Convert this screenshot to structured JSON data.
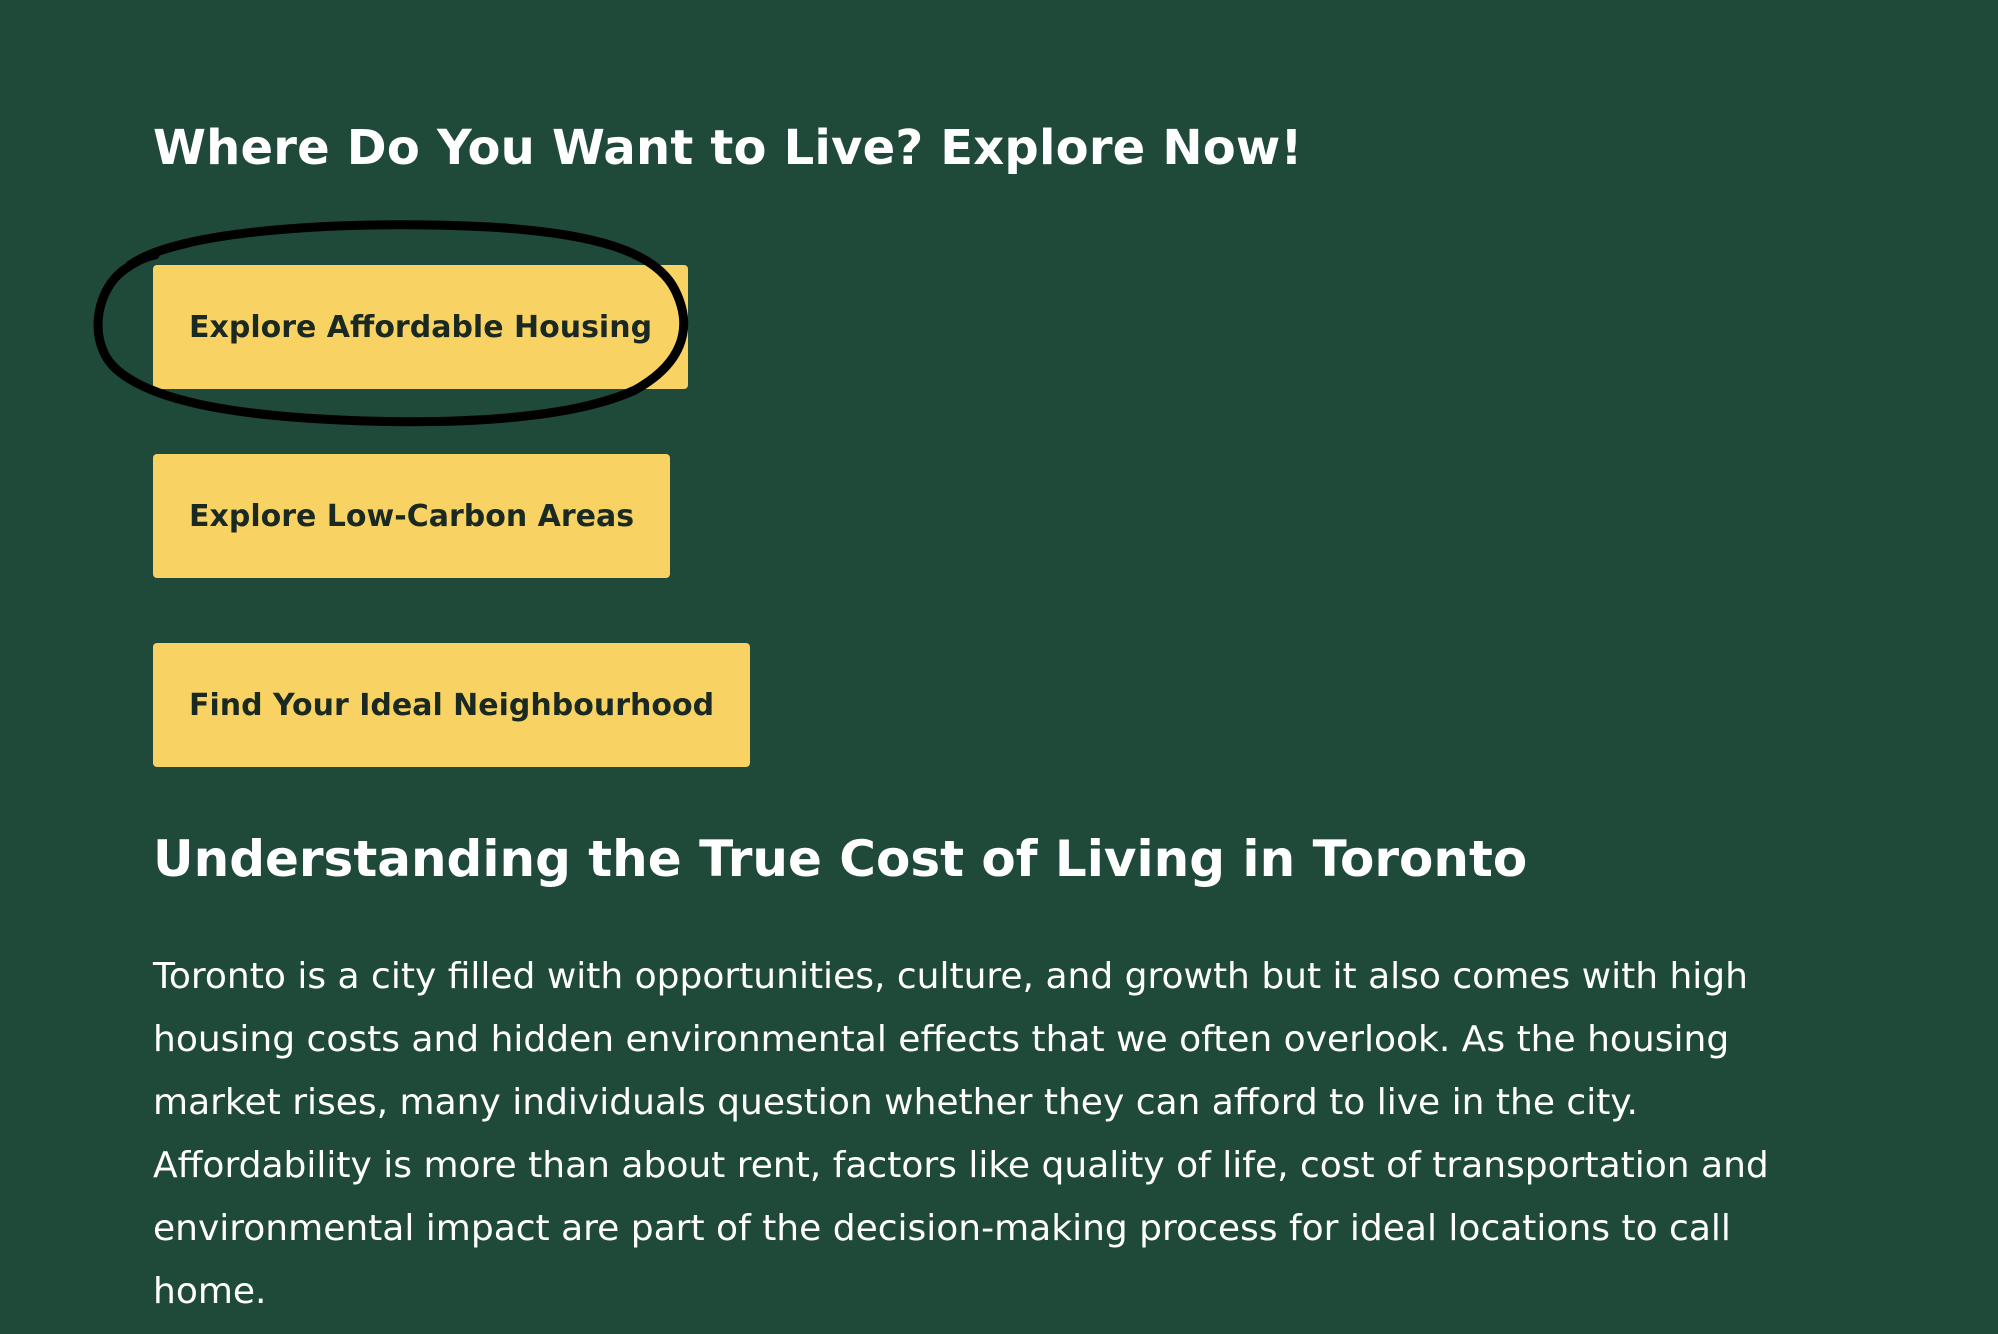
{
  "colors": {
    "background": "#1f4a3a",
    "button": "#f8d262",
    "button_text": "#1a2a22",
    "heading": "#ffffff",
    "annotation": "#000000"
  },
  "section_explore": {
    "title": "Where Do You Want to Live? Explore Now!",
    "buttons": [
      {
        "label": "Explore Affordable Housing"
      },
      {
        "label": "Explore Low-Carbon Areas"
      },
      {
        "label": "Find Your Ideal Neighbourhood"
      }
    ]
  },
  "section_cost": {
    "title": "Understanding the True Cost of Living in Toronto",
    "paragraph": "Toronto is a city filled with opportunities, culture, and growth but it also comes with high housing costs and hidden environmental effects that we often overlook. As the housing market rises, many individuals question whether they can afford to live in the city. Affordability is more than about rent, factors like quality of life, cost of transportation and environmental impact are part of the decision-making process for ideal locations to call home."
  }
}
